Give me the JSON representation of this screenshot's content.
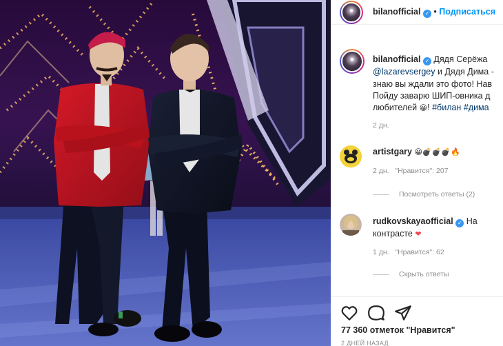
{
  "post": {
    "author": "bilanofficial",
    "follow_label": "Подписаться",
    "dot": "•"
  },
  "caption": {
    "line1": "Дядя Серёжа",
    "mention": "@lazarevsergey",
    "line2_rest": "и Дядя Дима -",
    "line3": "знаю вы ждали это фото! Нав",
    "line4": "Пойду заварю ШИП-овника д",
    "line5_pre": "любителей",
    "line5_emoji": "😀",
    "line5_mid": "!",
    "tag1": "#билан",
    "tag2": "#дима",
    "time": "2 дн."
  },
  "comments": [
    {
      "user": "artistgary",
      "emojis": "😀💣💣💣🔥",
      "time": "2 дн.",
      "likes": "\"Нравится\": 207",
      "replies": "Посмотреть ответы (2)"
    },
    {
      "user": "rudkovskayaofficial",
      "text1": "На",
      "text2": "контрасте",
      "emoji": "❤",
      "time": "1 дн.",
      "likes": "\"Нравится\": 62",
      "replies": "Скрыть ответы"
    }
  ],
  "footer": {
    "likes_count": "77 360 отметок \"Нравится\"",
    "timestamp": "2 ДНЕЙ НАЗАД"
  },
  "colors": {
    "accent_blue": "#0095f6",
    "verified_blue": "#3897f0",
    "heart_red": "#ed4956"
  },
  "icons": [
    "heart-icon",
    "comment-icon",
    "share-icon",
    "verified-icon"
  ]
}
